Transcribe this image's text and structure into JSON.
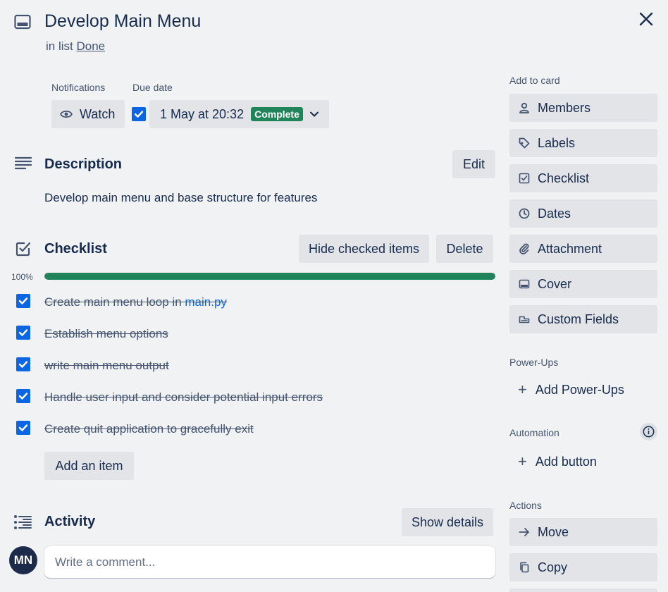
{
  "header": {
    "title": "Develop Main Menu",
    "list_prefix": "in list",
    "list_name": "Done",
    "close_label": "✕"
  },
  "meta": {
    "notifications_label": "Notifications",
    "watch_label": "Watch",
    "due_date_label": "Due date",
    "due_date_value": "1 May at 20:32",
    "due_status": "Complete"
  },
  "description": {
    "title": "Description",
    "edit_label": "Edit",
    "text": "Develop main menu and base structure for features"
  },
  "checklist": {
    "title": "Checklist",
    "hide_checked_label": "Hide checked items",
    "delete_label": "Delete",
    "progress_text": "100%",
    "progress_value": 1.0,
    "items": [
      {
        "text": "Create main menu loop in ",
        "link": "main.py",
        "checked": true
      },
      {
        "text": "Establish menu options",
        "checked": true
      },
      {
        "text": "write main menu output",
        "checked": true
      },
      {
        "text": "Handle user input and consider potential input errors",
        "checked": true
      },
      {
        "text": "Create quit application to gracefully exit",
        "checked": true
      }
    ],
    "add_item_label": "Add an item"
  },
  "activity": {
    "title": "Activity",
    "show_details_label": "Show details",
    "avatar_initials": "MN",
    "comment_placeholder": "Write a comment..."
  },
  "sidebar": {
    "add_to_card_label": "Add to card",
    "add_to_card": [
      {
        "label": "Members",
        "icon": "person-icon"
      },
      {
        "label": "Labels",
        "icon": "tag-icon"
      },
      {
        "label": "Checklist",
        "icon": "checklist-icon"
      },
      {
        "label": "Dates",
        "icon": "clock-icon"
      },
      {
        "label": "Attachment",
        "icon": "paperclip-icon"
      },
      {
        "label": "Cover",
        "icon": "cover-icon"
      },
      {
        "label": "Custom Fields",
        "icon": "custom-fields-icon"
      }
    ],
    "power_ups_label": "Power-Ups",
    "add_power_ups_label": "Add Power-Ups",
    "automation_label": "Automation",
    "add_button_label": "Add button",
    "actions_label": "Actions",
    "actions": [
      {
        "label": "Move",
        "icon": "arrow-right-icon"
      },
      {
        "label": "Copy",
        "icon": "copy-icon"
      }
    ]
  },
  "colors": {
    "accent": "#0c66e4",
    "success": "#1f845a",
    "background": "#f1f2f4",
    "button": "#e2e4e8",
    "avatar": "#1d2b4b"
  }
}
